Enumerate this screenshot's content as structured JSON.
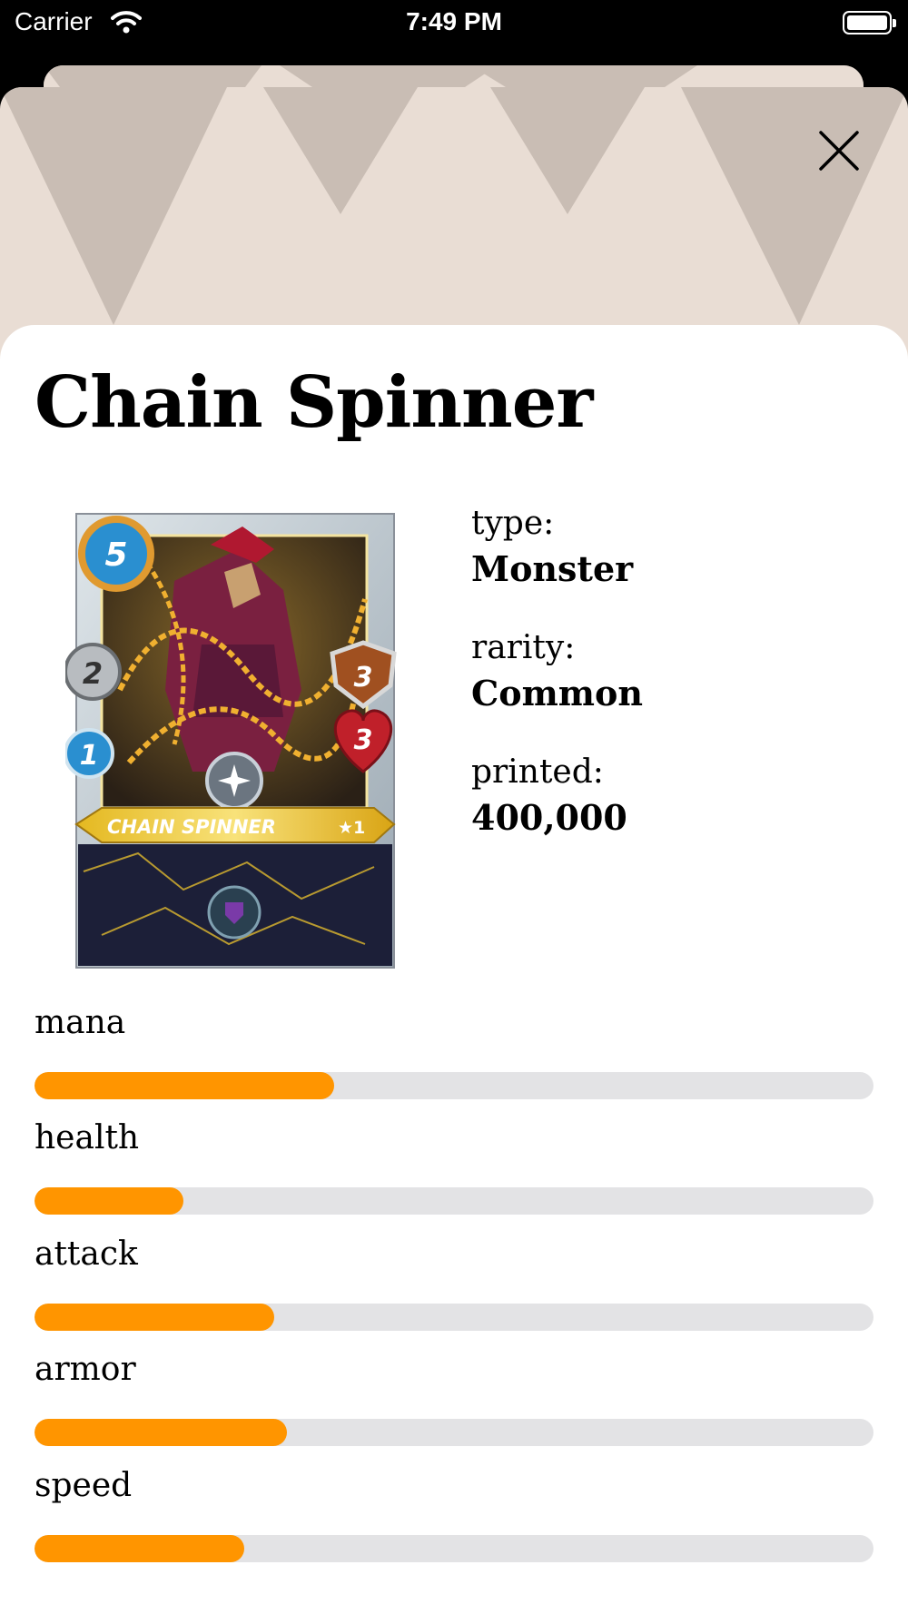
{
  "status_bar": {
    "carrier": "Carrier",
    "time": "7:49 PM"
  },
  "title": "Chain Spinner",
  "card_art": {
    "name_banner": "CHAIN SPINNER",
    "level": "★1",
    "mana": "5",
    "attack": "2",
    "speed": "1",
    "armor": "3",
    "health": "3"
  },
  "info": {
    "type_label": "type:",
    "type_value": "Monster",
    "rarity_label": "rarity:",
    "rarity_value": "Common",
    "printed_label": "printed:",
    "printed_value": "400,000"
  },
  "stats": [
    {
      "label": "mana",
      "fraction": 0.357
    },
    {
      "label": "health",
      "fraction": 0.177
    },
    {
      "label": "attack",
      "fraction": 0.286
    },
    {
      "label": "armor",
      "fraction": 0.301
    },
    {
      "label": "speed",
      "fraction": 0.25
    }
  ],
  "colors": {
    "accent": "#ff9500",
    "track": "#e3e3e5",
    "header_bg": "#e9ddd4",
    "header_triangles": "#c9bdb4"
  }
}
